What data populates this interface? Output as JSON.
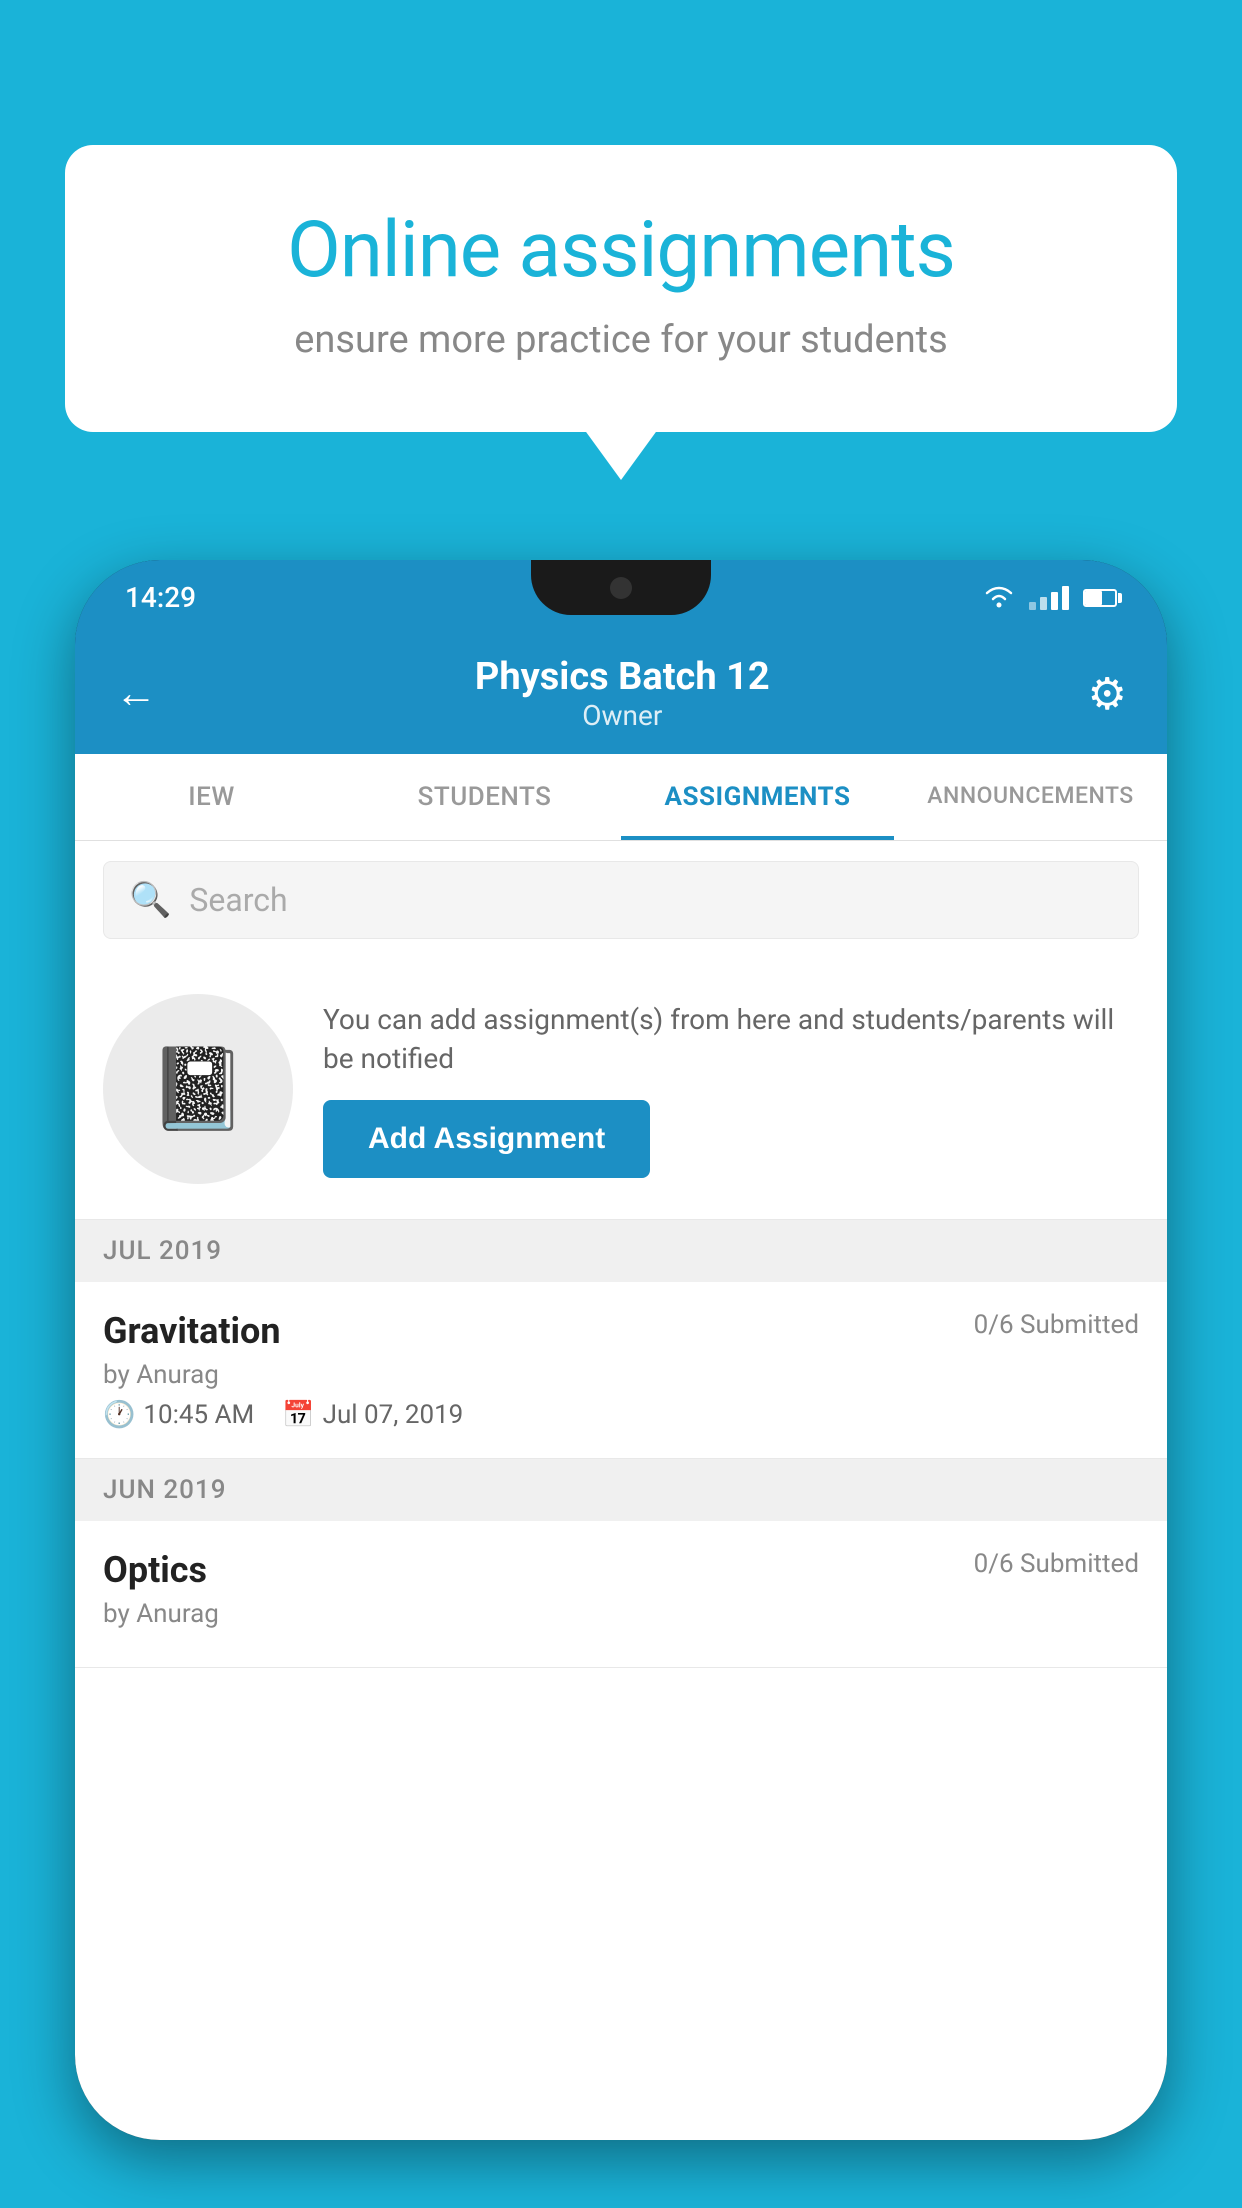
{
  "background_color": "#1ab3d8",
  "speech_bubble": {
    "title": "Online assignments",
    "subtitle": "ensure more practice for your students"
  },
  "phone": {
    "status_bar": {
      "time": "14:29",
      "wifi": true,
      "signal": true,
      "battery": true
    },
    "header": {
      "title": "Physics Batch 12",
      "subtitle": "Owner",
      "back_label": "←",
      "settings_label": "⚙"
    },
    "tabs": [
      {
        "id": "iew",
        "label": "IEW"
      },
      {
        "id": "students",
        "label": "STUDENTS"
      },
      {
        "id": "assignments",
        "label": "ASSIGNMENTS",
        "active": true
      },
      {
        "id": "announcements",
        "label": "ANNOUNCEMENTS"
      }
    ],
    "search": {
      "placeholder": "Search"
    },
    "promo": {
      "description": "You can add assignment(s) from here and students/parents will be notified",
      "button_label": "Add Assignment"
    },
    "sections": [
      {
        "label": "JUL 2019",
        "assignments": [
          {
            "name": "Gravitation",
            "submitted": "0/6 Submitted",
            "by": "by Anurag",
            "time": "10:45 AM",
            "date": "Jul 07, 2019"
          }
        ]
      },
      {
        "label": "JUN 2019",
        "assignments": [
          {
            "name": "Optics",
            "submitted": "0/6 Submitted",
            "by": "by Anurag",
            "time": "",
            "date": ""
          }
        ]
      }
    ]
  }
}
